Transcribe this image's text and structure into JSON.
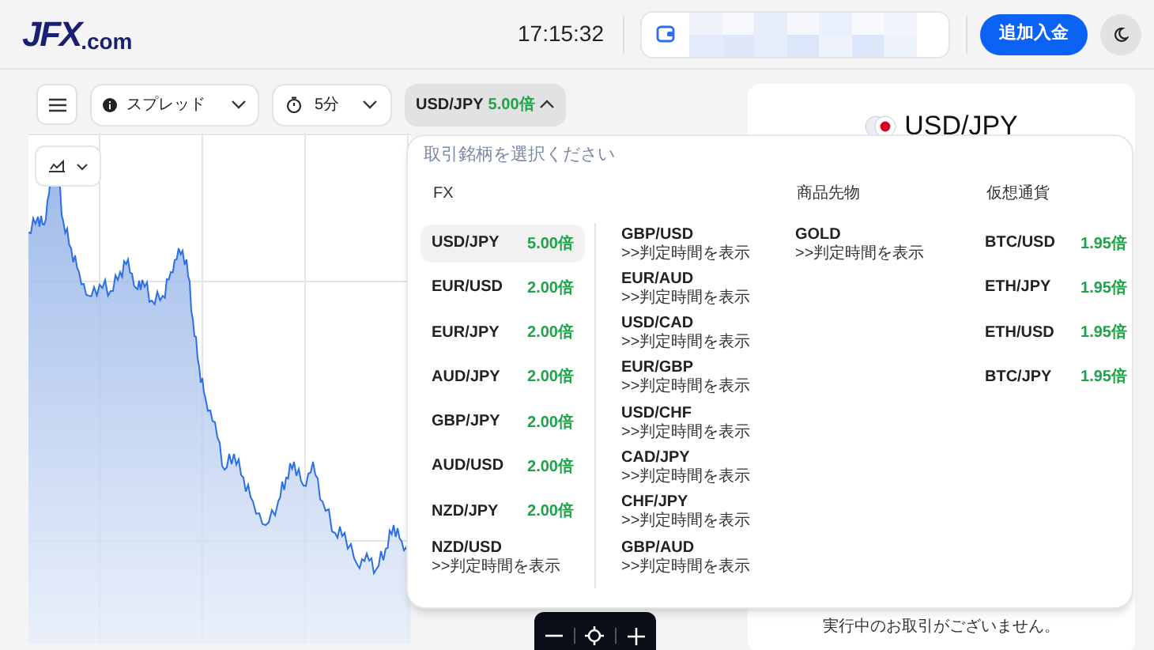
{
  "header": {
    "logo_main": "JFX",
    "logo_suffix": ".com",
    "time": "17:15:32",
    "deposit_button": "追加入金"
  },
  "toolbar": {
    "spread_select": "スプレッド",
    "timeframe_select": "5分",
    "symbol": {
      "label": "USD/JPY",
      "payout": "5.00倍",
      "expanded": true
    }
  },
  "picker": {
    "title": "取引銘柄を選択ください",
    "groups": [
      {
        "heading": "FX",
        "columns": [
          [
            {
              "kind": "payout",
              "symbol": "USD/JPY",
              "payout": "5.00倍",
              "selected": true
            },
            {
              "kind": "payout",
              "symbol": "EUR/USD",
              "payout": "2.00倍",
              "selected": false
            },
            {
              "kind": "payout",
              "symbol": "EUR/JPY",
              "payout": "2.00倍",
              "selected": false
            },
            {
              "kind": "payout",
              "symbol": "AUD/JPY",
              "payout": "2.00倍",
              "selected": false
            },
            {
              "kind": "payout",
              "symbol": "GBP/JPY",
              "payout": "2.00倍",
              "selected": false
            },
            {
              "kind": "payout",
              "symbol": "AUD/USD",
              "payout": "2.00倍",
              "selected": false
            },
            {
              "kind": "payout",
              "symbol": "NZD/JPY",
              "payout": "2.00倍",
              "selected": false
            },
            {
              "kind": "schedule",
              "symbol": "NZD/USD",
              "note": ">>判定時間を表示",
              "selected": false
            }
          ],
          [
            {
              "kind": "schedule",
              "symbol": "GBP/USD",
              "note": ">>判定時間を表示",
              "selected": false
            },
            {
              "kind": "schedule",
              "symbol": "EUR/AUD",
              "note": ">>判定時間を表示",
              "selected": false
            },
            {
              "kind": "schedule",
              "symbol": "USD/CAD",
              "note": ">>判定時間を表示",
              "selected": false
            },
            {
              "kind": "schedule",
              "symbol": "EUR/GBP",
              "note": ">>判定時間を表示",
              "selected": false
            },
            {
              "kind": "schedule",
              "symbol": "USD/CHF",
              "note": ">>判定時間を表示",
              "selected": false
            },
            {
              "kind": "schedule",
              "symbol": "CAD/JPY",
              "note": ">>判定時間を表示",
              "selected": false
            },
            {
              "kind": "schedule",
              "symbol": "CHF/JPY",
              "note": ">>判定時間を表示",
              "selected": false
            },
            {
              "kind": "schedule",
              "symbol": "GBP/AUD",
              "note": ">>判定時間を表示",
              "selected": false
            }
          ]
        ]
      },
      {
        "heading": "商品先物",
        "columns": [
          [
            {
              "kind": "schedule",
              "symbol": "GOLD",
              "note": ">>判定時間を表示",
              "selected": false
            }
          ]
        ]
      },
      {
        "heading": "仮想通貨",
        "columns": [
          [
            {
              "kind": "payout",
              "symbol": "BTC/USD",
              "payout": "1.95倍",
              "selected": false
            },
            {
              "kind": "payout",
              "symbol": "ETH/JPY",
              "payout": "1.95倍",
              "selected": false
            },
            {
              "kind": "payout",
              "symbol": "ETH/USD",
              "payout": "1.95倍",
              "selected": false
            },
            {
              "kind": "payout",
              "symbol": "BTC/JPY",
              "payout": "1.95倍",
              "selected": false
            }
          ]
        ]
      }
    ]
  },
  "side_panel": {
    "title": "USD/JPY",
    "empty_message": "実行中のお取引がございません。"
  }
}
